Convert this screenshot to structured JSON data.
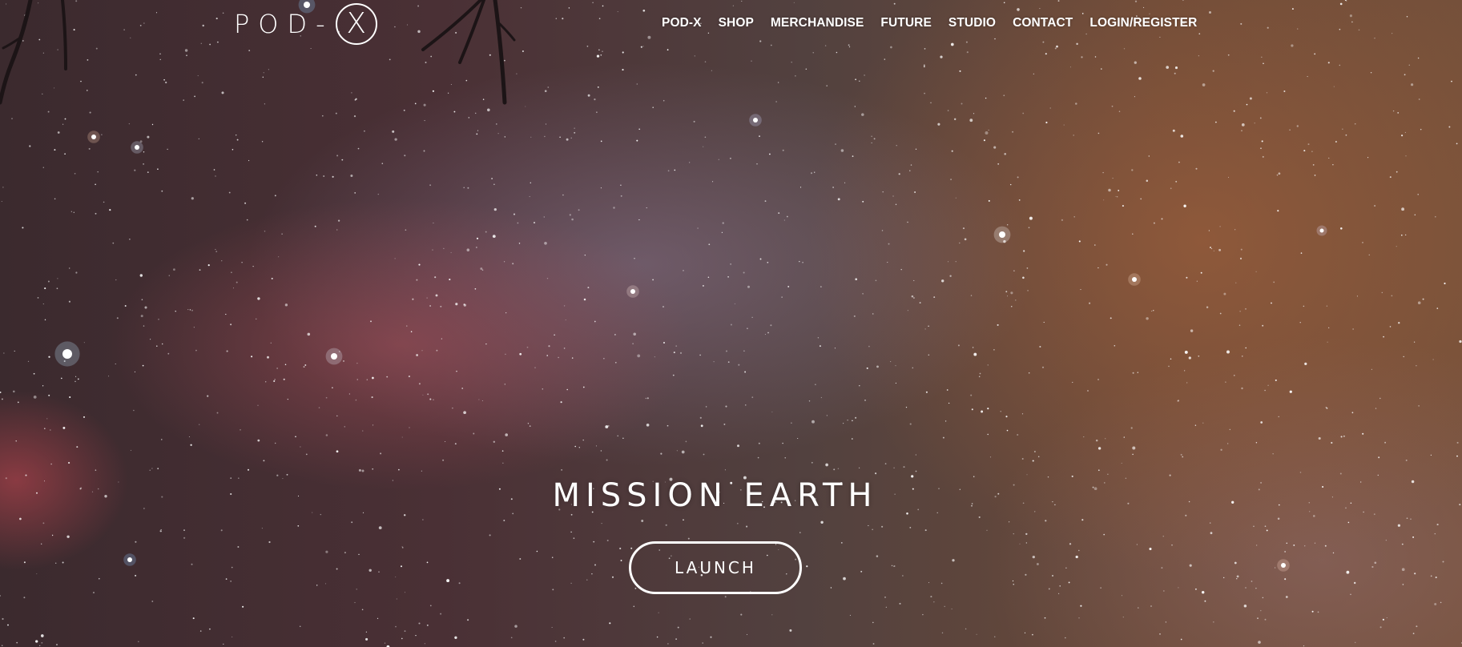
{
  "header": {
    "logo_text": "POD-",
    "logo_mark": "X",
    "nav": [
      {
        "label": "POD-X"
      },
      {
        "label": "SHOP"
      },
      {
        "label": "MERCHANDISE"
      },
      {
        "label": "FUTURE"
      },
      {
        "label": "STUDIO"
      },
      {
        "label": "CONTACT"
      },
      {
        "label": "LOGIN/REGISTER"
      }
    ]
  },
  "hero": {
    "headline": "MISSION EARTH",
    "cta_label": "LAUNCH",
    "background": "starry-night-sky-image"
  },
  "colors": {
    "text": "#ffffff",
    "sky_base": "#4a3035",
    "sky_warm": "#74503a"
  }
}
